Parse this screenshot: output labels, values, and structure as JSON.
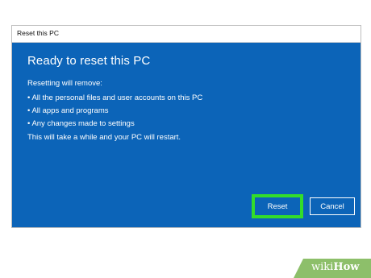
{
  "window": {
    "title": "Reset this PC"
  },
  "dialog": {
    "heading": "Ready to reset this PC",
    "subheading": "Resetting will remove:",
    "items": [
      "• All the personal files and user accounts on this PC",
      "• All apps and programs",
      "• Any changes made to settings"
    ],
    "note": "This will take a while and your PC will restart.",
    "reset_label": "Reset",
    "cancel_label": "Cancel"
  },
  "colors": {
    "dialog_background": "#0c64b8",
    "highlight": "#33dd2a",
    "watermark": "#8dbf6a"
  },
  "watermark": {
    "prefix": "wiki",
    "suffix": "How"
  }
}
